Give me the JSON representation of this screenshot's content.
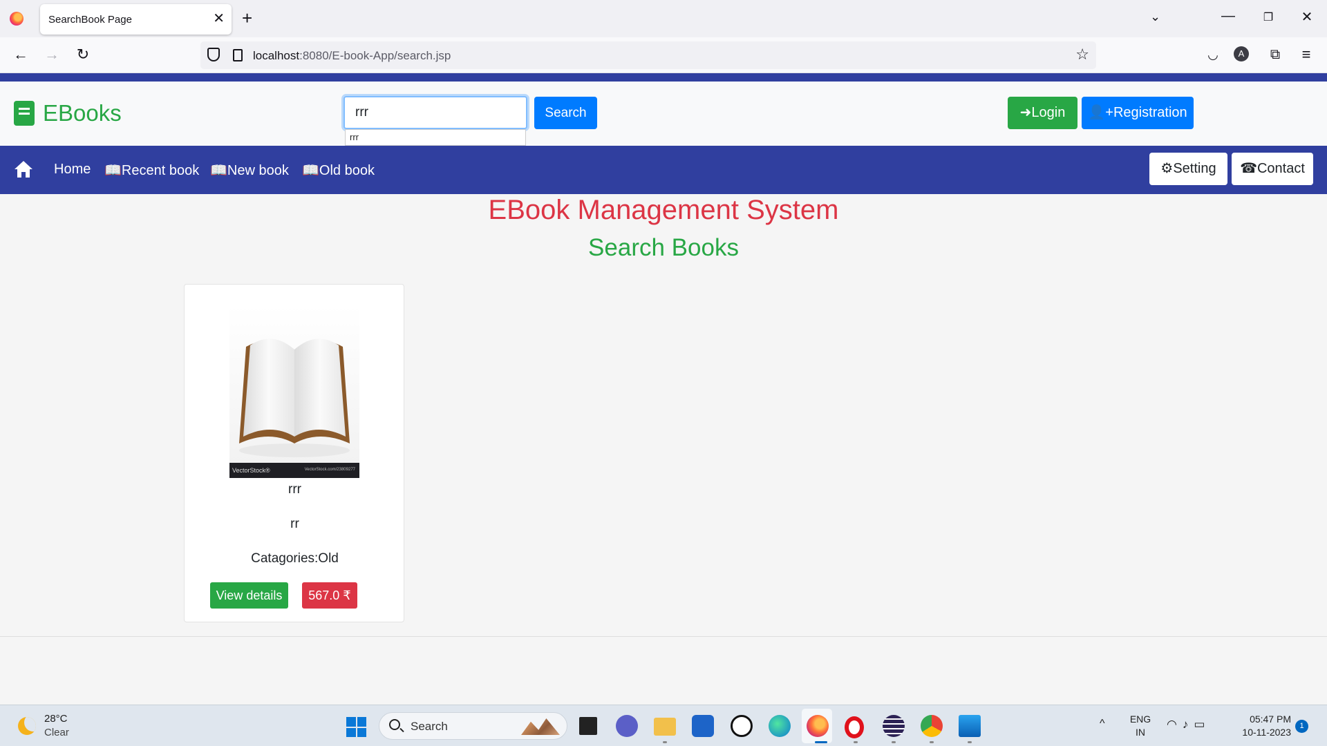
{
  "browser": {
    "tab_title": "SearchBook Page",
    "tab_close": "✕",
    "new_tab": "+",
    "url_host": "localhost",
    "url_rest": ":8080/E-book-App/search.jsp"
  },
  "header": {
    "brand": "EBooks",
    "search_value": "rrr",
    "autocomplete_item": "rrr",
    "search_button": "Search",
    "login_button": "Login",
    "register_button": "Registration"
  },
  "nav": {
    "home": "Home",
    "recent": "Recent book",
    "new": "New book",
    "old": "Old book",
    "setting": "Setting",
    "contact": "Contact"
  },
  "main": {
    "title": "EBook Management System",
    "subtitle": "Search Books"
  },
  "book": {
    "cover_watermark": "VectorStock®",
    "cover_code": "VectorStock.com/23809277",
    "name": "rrr",
    "author": "rr",
    "category": "Catagories:Old",
    "details_button": "View details",
    "price": "567.0",
    "currency": "₹"
  },
  "taskbar": {
    "temp": "28°C",
    "condition": "Clear",
    "search": "Search",
    "lang_1": "ENG",
    "lang_2": "IN",
    "time": "05:47 PM",
    "date": "10-11-2023",
    "notifications": "1"
  },
  "colors": {
    "nav_blue": "#303f9f",
    "brand_green": "#28a745",
    "primary_blue": "#007bff",
    "title_red": "#dc3545"
  }
}
